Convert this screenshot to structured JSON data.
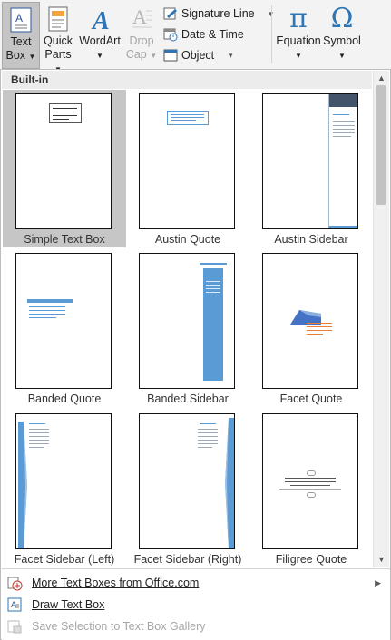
{
  "ribbon": {
    "text_box": {
      "line1": "Text",
      "line2": "Box"
    },
    "quick_parts": {
      "line1": "Quick",
      "line2": "Parts"
    },
    "wordart": {
      "line1": "WordArt"
    },
    "drop_cap": {
      "line1": "Drop",
      "line2": "Cap"
    },
    "signature_line": "Signature Line",
    "date_time": "Date & Time",
    "object": "Object",
    "equation": "Equation",
    "symbol": "Symbol",
    "pi_glyph": "π",
    "omega_glyph": "Ω",
    "wordart_glyph": "A"
  },
  "gallery": {
    "section_header": "Built-in",
    "items": [
      {
        "label": "Simple Text Box",
        "selected": true
      },
      {
        "label": "Austin Quote"
      },
      {
        "label": "Austin Sidebar"
      },
      {
        "label": "Banded Quote"
      },
      {
        "label": "Banded Sidebar"
      },
      {
        "label": "Facet Quote"
      },
      {
        "label": "Facet Sidebar (Left)"
      },
      {
        "label": "Facet Sidebar (Right)"
      },
      {
        "label": "Filigree Quote"
      }
    ]
  },
  "menu": {
    "more_text_boxes": "More Text Boxes from Office.com",
    "draw_text_box": "Draw Text Box",
    "save_selection": "Save Selection to Text Box Gallery"
  },
  "colors": {
    "accent_blue": "#5b9bd5",
    "dark_header": "#44546a",
    "facet_blue": "#4472c4",
    "orange": "#ed7d31"
  }
}
